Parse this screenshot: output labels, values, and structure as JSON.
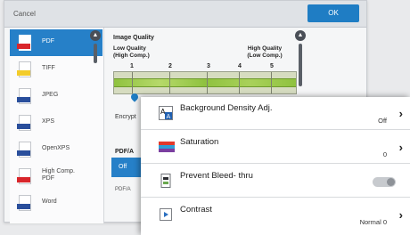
{
  "topbar": {
    "cancel_label": "Cancel",
    "ok_label": "OK"
  },
  "file_types": [
    {
      "label": "PDF",
      "icon": "pdf-file-icon",
      "color": "#d9262b",
      "selected": true
    },
    {
      "label": "TIFF",
      "icon": "tiff-file-icon",
      "color": "#f3cc2a",
      "selected": false
    },
    {
      "label": "JPEG",
      "icon": "jpeg-file-icon",
      "color": "#2a4f9c",
      "selected": false
    },
    {
      "label": "XPS",
      "icon": "xps-file-icon",
      "color": "#2a4f9c",
      "selected": false
    },
    {
      "label": "OpenXPS",
      "icon": "openxps-file-icon",
      "color": "#2a4f9c",
      "selected": false
    },
    {
      "label": "High Comp. PDF",
      "icon": "high-comp-pdf-icon",
      "color": "#d9262b",
      "selected": false
    },
    {
      "label": "Word",
      "icon": "word-file-icon",
      "color": "#2a4f9c",
      "selected": false
    }
  ],
  "image_quality": {
    "title": "Image Quality",
    "low_label_1": "Low Quality",
    "low_label_2": "(High Comp.)",
    "high_label_1": "High Quality",
    "high_label_2": "(Low Comp.)",
    "levels": [
      "1",
      "2",
      "3",
      "4",
      "5"
    ],
    "selected_level": 1
  },
  "encrypt_label": "Encrypt",
  "pdfa": {
    "title": "PDF/A",
    "value": "Off",
    "small_label": "PDF/A"
  },
  "popup": {
    "rows": [
      {
        "title": "Background Density Adj.",
        "value": "Off",
        "icon": "background-density-icon",
        "control": "chevron"
      },
      {
        "title": "Saturation",
        "value": "0",
        "icon": "saturation-icon",
        "control": "chevron"
      },
      {
        "title": "Prevent Bleed- thru",
        "value": "",
        "icon": "prevent-bleed-thru-icon",
        "control": "toggle",
        "toggle_on": false
      },
      {
        "title": "Contrast",
        "value": "Normal 0",
        "icon": "contrast-icon",
        "control": "chevron"
      }
    ]
  },
  "colors": {
    "accent": "#2680c8",
    "ok_button": "#1f7dc4",
    "scale_green": "#8fc23f"
  }
}
